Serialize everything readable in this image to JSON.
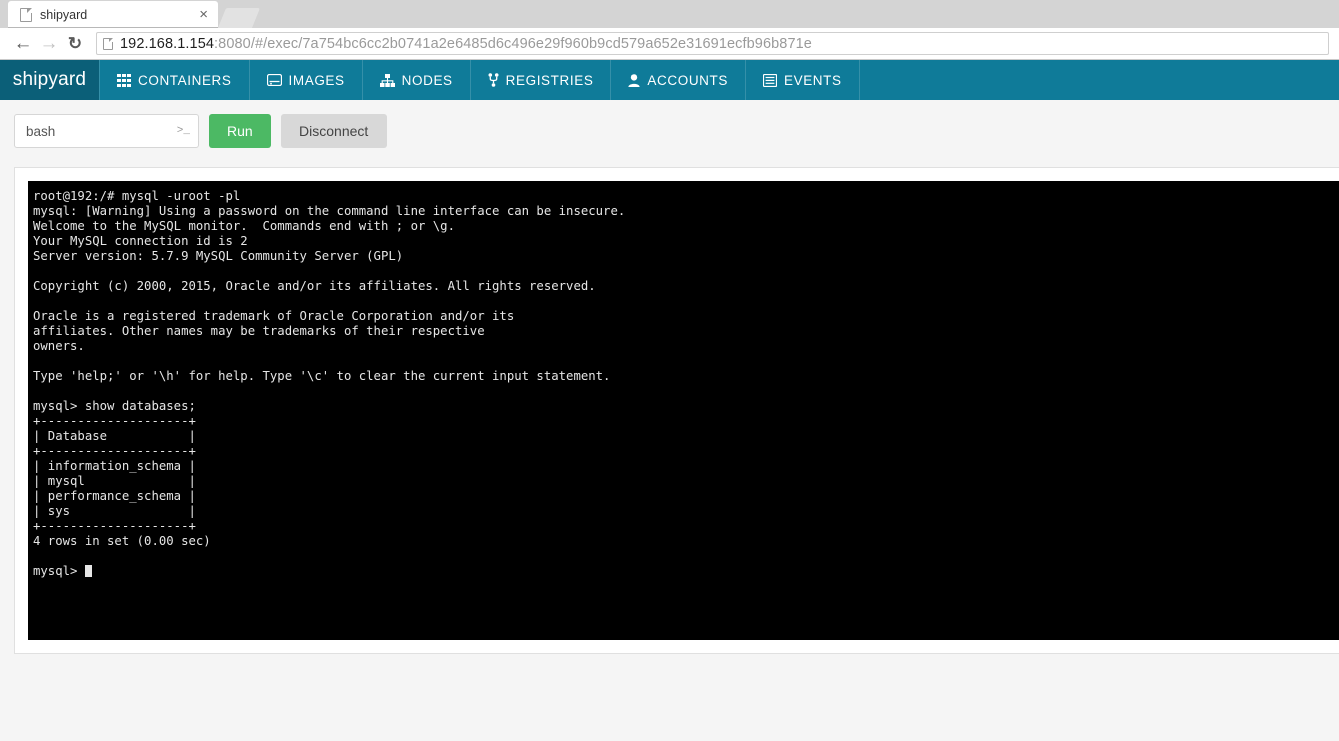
{
  "browser": {
    "tab": {
      "title": "shipyard",
      "close_label": "×",
      "favicon": "page-icon"
    },
    "nav": {
      "back": "←",
      "forward": "→",
      "reload": "↻"
    },
    "omnibox": {
      "page_icon": "page-icon",
      "host": "192.168.1.154",
      "path": ":8080/#/exec/7a754bc6cc2b0741a2e6485d6c496e29f960b9cd579a652e31691ecfb96b871e",
      "full_url": "192.168.1.154:8080/#/exec/7a754bc6cc2b0741a2e6485d6c496e29f960b9cd579a652e31691ecfb96b871e"
    }
  },
  "app": {
    "brand": "shipyard",
    "brand_color": "#0b5f78",
    "navbar_color": "#0f7b99",
    "nav_items": [
      {
        "label": "CONTAINERS",
        "icon": "grid-icon"
      },
      {
        "label": "IMAGES",
        "icon": "hard-drive-icon"
      },
      {
        "label": "NODES",
        "icon": "sitemap-icon"
      },
      {
        "label": "REGISTRIES",
        "icon": "code-fork-icon"
      },
      {
        "label": "ACCOUNTS",
        "icon": "user-icon"
      },
      {
        "label": "EVENTS",
        "icon": "list-icon"
      }
    ]
  },
  "toolbar": {
    "command_value": "bash",
    "command_placeholder": "bash",
    "command_icon": ">_",
    "run_label": "Run",
    "run_color": "#4cb964",
    "disconnect_label": "Disconnect",
    "disconnect_color": "#d8d8d8"
  },
  "terminal": {
    "background": "#000000",
    "foreground": "#e6e6e6",
    "lines": [
      "root@192:/# mysql -uroot -pl",
      "mysql: [Warning] Using a password on the command line interface can be insecure.",
      "Welcome to the MySQL monitor.  Commands end with ; or \\g.",
      "Your MySQL connection id is 2",
      "Server version: 5.7.9 MySQL Community Server (GPL)",
      "",
      "Copyright (c) 2000, 2015, Oracle and/or its affiliates. All rights reserved.",
      "",
      "Oracle is a registered trademark of Oracle Corporation and/or its",
      "affiliates. Other names may be trademarks of their respective",
      "owners.",
      "",
      "Type 'help;' or '\\h' for help. Type '\\c' to clear the current input statement.",
      "",
      "mysql> show databases;",
      "+--------------------+",
      "| Database           |",
      "+--------------------+",
      "| information_schema |",
      "| mysql              |",
      "| performance_schema |",
      "| sys                |",
      "+--------------------+",
      "4 rows in set (0.00 sec)",
      "",
      "mysql> "
    ],
    "prompt": "mysql> ",
    "query": "show databases;",
    "result_table": {
      "columns": [
        "Database"
      ],
      "rows": [
        [
          "information_schema"
        ],
        [
          "mysql"
        ],
        [
          "performance_schema"
        ],
        [
          "sys"
        ]
      ],
      "row_count_text": "4 rows in set (0.00 sec)"
    }
  }
}
